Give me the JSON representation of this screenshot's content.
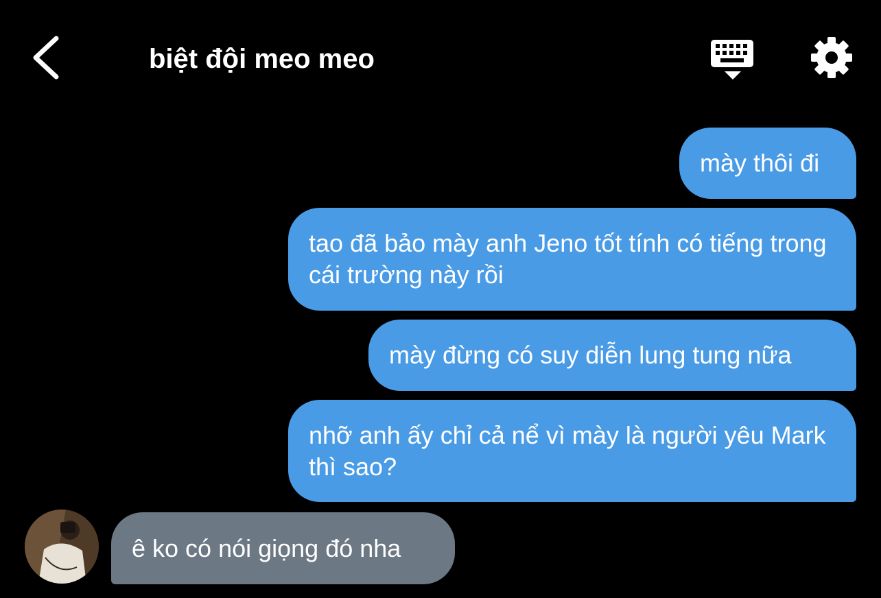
{
  "header": {
    "title": "biệt đội meo meo",
    "icons": {
      "back": "chevron-left-icon",
      "keyboard": "keyboard-icon",
      "settings": "gear-icon"
    }
  },
  "messages": [
    {
      "direction": "outgoing",
      "text": "mày thôi đi"
    },
    {
      "direction": "outgoing",
      "text": "tao đã bảo mày anh Jeno tốt tính có tiếng trong cái trường này rồi"
    },
    {
      "direction": "outgoing",
      "text": "mày đừng có suy diễn lung tung nữa"
    },
    {
      "direction": "outgoing",
      "text": "nhỡ anh ấy chỉ cả nể vì mày là người yêu Mark thì sao?"
    },
    {
      "direction": "incoming",
      "text": "ê ko có nói giọng đó nha"
    }
  ],
  "colors": {
    "background": "#000000",
    "outgoing_bubble": "#4a9be6",
    "incoming_bubble": "#6c7884",
    "text": "#ffffff"
  }
}
